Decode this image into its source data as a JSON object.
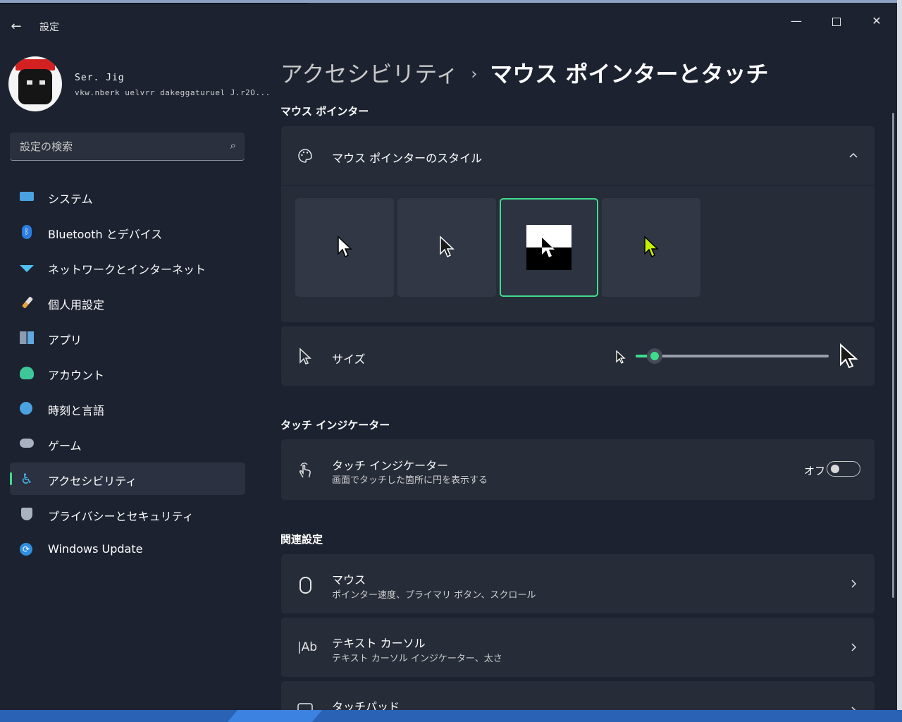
{
  "window": {
    "title": "設定"
  },
  "profile": {
    "name": "Ser. Jig",
    "email": "vkw.nberk uelvrr dakeggaturuel J.r2O..."
  },
  "search": {
    "placeholder": "設定の検索"
  },
  "nav": {
    "items": [
      {
        "label": "システム",
        "icon": "monitor-icon"
      },
      {
        "label": "Bluetooth とデバイス",
        "icon": "bluetooth-icon"
      },
      {
        "label": "ネットワークとインターネット",
        "icon": "wifi-icon"
      },
      {
        "label": "個人用設定",
        "icon": "brush-icon"
      },
      {
        "label": "アプリ",
        "icon": "apps-icon"
      },
      {
        "label": "アカウント",
        "icon": "person-icon"
      },
      {
        "label": "時刻と言語",
        "icon": "clock-globe-icon"
      },
      {
        "label": "ゲーム",
        "icon": "gamepad-icon"
      },
      {
        "label": "アクセシビリティ",
        "icon": "accessibility-icon",
        "selected": true
      },
      {
        "label": "プライバシーとセキュリティ",
        "icon": "shield-icon"
      },
      {
        "label": "Windows Update",
        "icon": "update-icon"
      }
    ]
  },
  "breadcrumb": {
    "parent": "アクセシビリティ",
    "separator": "›",
    "current": "マウス ポインターとタッチ"
  },
  "mouse_pointer": {
    "section_title": "マウス ポインター",
    "style_label": "マウス ポインターのスタイル",
    "styles": [
      {
        "name": "white",
        "selected": false
      },
      {
        "name": "black",
        "selected": false
      },
      {
        "name": "inverted",
        "selected": true
      },
      {
        "name": "custom",
        "selected": false,
        "color": "#c6f000"
      }
    ],
    "size_label": "サイズ",
    "size_value_fraction": 0.1
  },
  "touch": {
    "section_title": "タッチ インジケーター",
    "title": "タッチ インジケーター",
    "subtitle": "画面でタッチした箇所に円を表示する",
    "toggle_label": "オフ",
    "toggle_on": false
  },
  "related": {
    "section_title": "関連設定",
    "items": [
      {
        "title": "マウス",
        "subtitle": "ポインター速度、プライマリ ボタン、スクロール"
      },
      {
        "title": "テキスト カーソル",
        "subtitle": "テキスト カーソル インジケーター、太さ"
      },
      {
        "title": "タッチパッド",
        "subtitle": ""
      }
    ]
  },
  "colors": {
    "accent": "#3fdc8e",
    "background": "#1c2230",
    "card": "#262c38"
  }
}
